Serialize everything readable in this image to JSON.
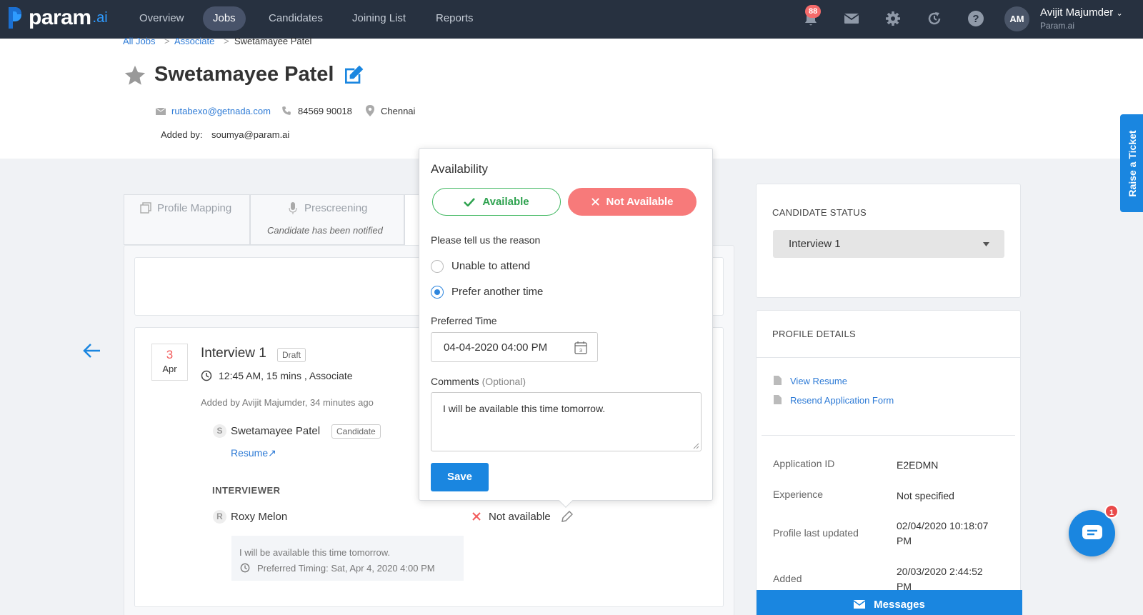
{
  "nav": {
    "logo_text": "param",
    "logo_suffix": ".ai",
    "items": [
      {
        "label": "Overview"
      },
      {
        "label": "Jobs",
        "active": true
      },
      {
        "label": "Candidates"
      },
      {
        "label": "Joining List"
      },
      {
        "label": "Reports"
      }
    ],
    "notification_count": "88",
    "user": {
      "initials": "AM",
      "name": "Avijit Majumder",
      "org": "Param.ai"
    }
  },
  "breadcrumb": [
    "All Jobs",
    "Associate",
    "Swetamayee Patel"
  ],
  "candidate": {
    "name": "Swetamayee Patel",
    "email": "rutabexo@getnada.com",
    "phone": "84569 90018",
    "location": "Chennai",
    "added_by_label": "Added by:",
    "added_by": "soumya@param.ai"
  },
  "tabs": [
    {
      "label": "Profile Mapping"
    },
    {
      "label": "Prescreening",
      "sub": "Candidate has been notified"
    }
  ],
  "interview": {
    "day": "3",
    "month": "Apr",
    "title": "Interview 1",
    "status_tag": "Draft",
    "time": "12:45 AM, 15 mins , Associate",
    "added_line": "Added by Avijit Majumder, 34 minutes ago",
    "candidate_initial": "S",
    "candidate_name": "Swetamayee Patel",
    "candidate_tag": "Candidate",
    "resume_link": "Resume↗",
    "interviewer_heading": "INTERVIEWER",
    "interviewer_initial": "R",
    "interviewer_name": "Roxy Melon",
    "interviewer_status": "Not available",
    "note_text": "I will be available this time tomorrow.",
    "note_timing": "Preferred Timing: Sat, Apr 4, 2020 4:00 PM"
  },
  "availability_popover": {
    "title": "Availability",
    "available_label": "Available",
    "not_available_label": "Not Available",
    "reason_prompt": "Please tell us the reason",
    "reasons": [
      {
        "label": "Unable to attend",
        "selected": false
      },
      {
        "label": "Prefer another time",
        "selected": true
      }
    ],
    "preferred_time_label": "Preferred Time",
    "preferred_time_value": "04-04-2020 04:00 PM",
    "calendar_day": "3",
    "comments_label": "Comments",
    "comments_optional": "(Optional)",
    "comments_value": "I will be available this time tomorrow.",
    "save_label": "Save"
  },
  "right_panel": {
    "status_heading": "CANDIDATE STATUS",
    "status_value": "Interview 1",
    "profile_heading": "PROFILE DETAILS",
    "links": [
      "View Resume",
      "Resend Application Form"
    ],
    "details": [
      {
        "label": "Application ID",
        "value": "E2EDMN"
      },
      {
        "label": "Experience",
        "value": "Not specified"
      },
      {
        "label": "Profile last updated",
        "value": "02/04/2020 10:18:07 PM"
      },
      {
        "label": "Added",
        "value": "20/03/2020 2:44:52 PM"
      }
    ]
  },
  "messages_label": "Messages",
  "raise_ticket_label": "Raise a Ticket",
  "chat_badge": "1",
  "colors": {
    "nav_bg": "#273140",
    "primary": "#1a86e0",
    "available_green": "#2ea24f",
    "not_available_red": "#f77a7a"
  }
}
